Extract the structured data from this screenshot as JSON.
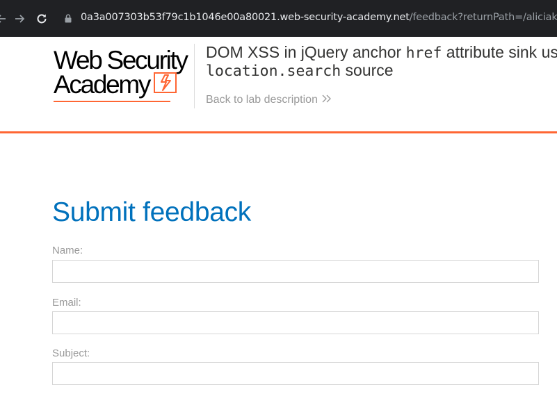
{
  "browser": {
    "url_domain": "0a3a007303b53f79c1b1046e00a80021.web-security-academy.net",
    "url_path": "/feedback?returnPath=/aliciakeys"
  },
  "header": {
    "logo_line1": "Web Security",
    "logo_line2": "Academy",
    "title_part1": "DOM XSS in jQuery anchor ",
    "title_code1": "href",
    "title_part2": " attribute sink using",
    "title_code2": "location.search",
    "title_part3": " source",
    "back_link": "Back to lab description"
  },
  "form": {
    "heading": "Submit feedback",
    "name_label": "Name:",
    "name_value": "",
    "email_label": "Email:",
    "email_value": "",
    "subject_label": "Subject:",
    "subject_value": ""
  },
  "colors": {
    "accent": "#ff6633",
    "heading": "#0071bc",
    "label": "#999999"
  }
}
